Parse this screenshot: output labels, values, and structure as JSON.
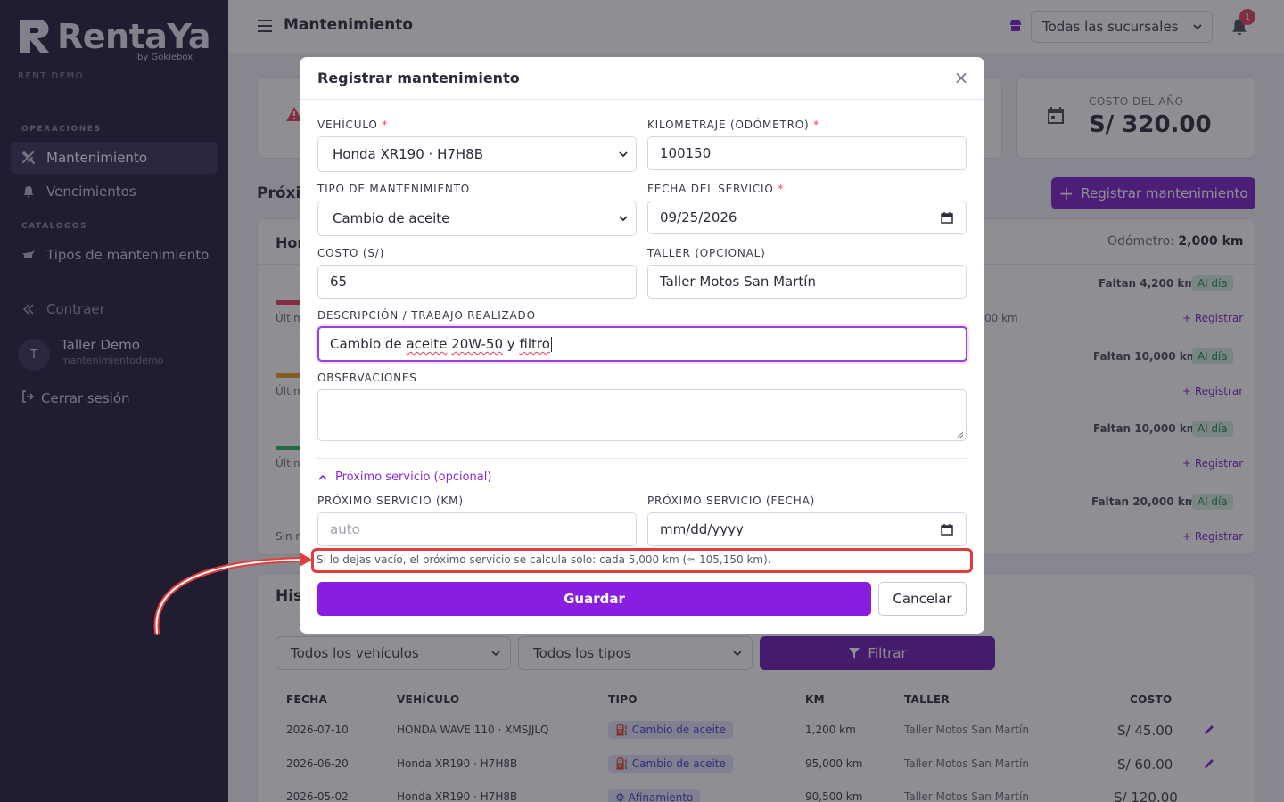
{
  "sidebar": {
    "logo_text": "RentaYa",
    "logo_by": "by Gokiebox",
    "tenant": "RENT DEMO",
    "sections": {
      "operaciones": "OPERACIONES",
      "catalogos": "CATÁLOGOS"
    },
    "items": [
      {
        "label": "Mantenimiento",
        "icon": "wrench-icon"
      },
      {
        "label": "Vencimientos",
        "icon": "bell-icon"
      },
      {
        "label": "Tipos de mantenimiento",
        "icon": "oil-can-icon"
      },
      {
        "label": "Contraer",
        "icon": "double-chevron-left-icon"
      }
    ],
    "user": {
      "initial": "T",
      "name": "Taller Demo",
      "username": "mantenimientodemo"
    },
    "logout": "Cerrar sesión"
  },
  "topbar": {
    "title": "Mantenimiento",
    "branch_select": "Todas las sucursales",
    "notifications": "1"
  },
  "background": {
    "stat_label": "COSTO DEL AÑO",
    "stat_value": "S/ 320.00",
    "register_button": "Registrar mantenimiento",
    "section_title": "Próxim",
    "vehicle_head": "Hor",
    "odometer_label": "Odómetro:",
    "odometer_value": "2,000 km",
    "rows": [
      {
        "falta": "Faltan 4,200 km",
        "status": "Al día",
        "link": "Registrar",
        "sub": "Últim",
        "extra": "00 km"
      },
      {
        "falta": "Faltan 10,000 km",
        "status": "Al día",
        "link": "Registrar",
        "sub": "Últim"
      },
      {
        "falta": "Faltan 10,000 km",
        "status": "Al día",
        "link": "Registrar",
        "sub": "Últim"
      },
      {
        "falta": "Faltan 20,000 km",
        "status": "Al día",
        "link": "Registrar",
        "sub": "Sin re"
      }
    ],
    "history_title": "Hist",
    "filters": {
      "vehicles": "Todos los vehículos",
      "types": "Todos los tipos",
      "button": "Filtrar"
    },
    "table": {
      "headers": [
        "FECHA",
        "VEHÍCULO",
        "TIPO",
        "KM",
        "TALLER",
        "COSTO"
      ],
      "rows": [
        [
          "2026-07-10",
          "HONDA WAVE 110 · XMSJJLQ",
          "Cambio de aceite",
          "1,200 km",
          "Taller Motos San Martín",
          "S/ 45.00"
        ],
        [
          "2026-06-20",
          "Honda XR190 · H7H8B",
          "Cambio de aceite",
          "95,000 km",
          "Taller Motos San Martín",
          "S/ 60.00"
        ],
        [
          "2026-05-02",
          "Honda XR190 · H7H8B",
          "Afinamiento",
          "90,500 km",
          "Taller Motos San Martín",
          "S/ 120.00"
        ]
      ]
    }
  },
  "modal": {
    "title": "Registrar mantenimiento",
    "fields": {
      "vehiculo": {
        "label": "VEHÍCULO",
        "value": "Honda XR190 · H7H8B"
      },
      "kilometraje": {
        "label": "KILOMETRAJE (ODÓMETRO)",
        "value": "100150"
      },
      "tipo": {
        "label": "TIPO DE MANTENIMIENTO",
        "value": "Cambio de aceite"
      },
      "fecha": {
        "label": "FECHA DEL SERVICIO",
        "value": "09/25/2026"
      },
      "costo": {
        "label": "COSTO (S/)",
        "value": "65"
      },
      "taller": {
        "label": "TALLER (OPCIONAL)",
        "value": "Taller Motos San Martín"
      },
      "descripcion": {
        "label": "DESCRIPCIÓN / TRABAJO REALIZADO",
        "value_plain_1": "Cambio de ",
        "value_spell_1": "aceite",
        "value_plain_2": " ",
        "value_spell_2": "20W-50",
        "value_plain_3": " y ",
        "value_spell_3": "filtro"
      },
      "observaciones": {
        "label": "OBSERVACIONES"
      },
      "proximo_km": {
        "label": "PRÓXIMO SERVICIO (KM)",
        "placeholder": "auto"
      },
      "proximo_fecha": {
        "label": "PRÓXIMO SERVICIO (FECHA)",
        "placeholder": "mm/dd/yyyy"
      }
    },
    "required_mark": "*",
    "toggle": "Próximo servicio (opcional)",
    "hint": "Si lo dejas vacío, el próximo servicio se calcula solo: cada 5,000 km (≈ 105,150 km).",
    "save": "Guardar",
    "cancel": "Cancelar"
  },
  "colors": {
    "primary": "#8a1ee0",
    "sidebar": "#221a3a",
    "annotation": "#e23c3c"
  }
}
